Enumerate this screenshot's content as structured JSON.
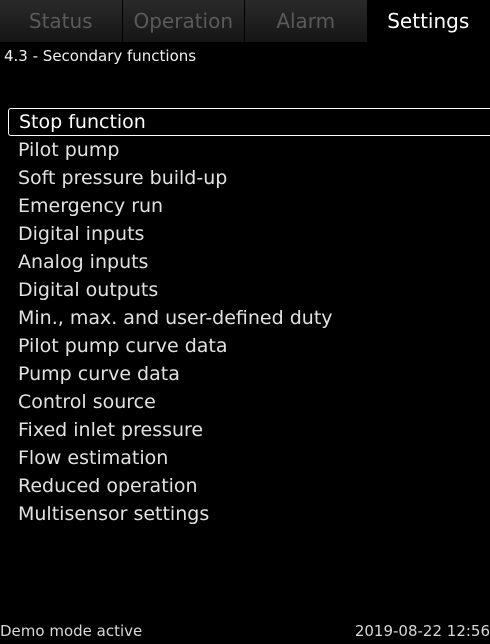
{
  "tabs": [
    {
      "label": "Status",
      "active": false
    },
    {
      "label": "Operation",
      "active": false
    },
    {
      "label": "Alarm",
      "active": false
    },
    {
      "label": "Settings",
      "active": true
    }
  ],
  "page_title": "4.3 - Secondary functions",
  "menu": {
    "selected_index": 0,
    "items": [
      "Stop function",
      "Pilot pump",
      "Soft pressure build-up",
      "Emergency run",
      "Digital inputs",
      "Analog inputs",
      "Digital outputs",
      "Min., max. and user-defined duty",
      "Pilot pump curve data",
      "Pump curve data",
      "Control source",
      "Fixed inlet pressure",
      "Flow estimation",
      "Reduced operation",
      "Multisensor settings"
    ]
  },
  "footer": {
    "mode": "Demo mode active",
    "datetime": "2019-08-22 12:56"
  },
  "colors": {
    "background": "#000000",
    "text": "#e6e6e6",
    "inactive_tab_text": "#5a5a5a",
    "selection_border": "#ffffff"
  }
}
